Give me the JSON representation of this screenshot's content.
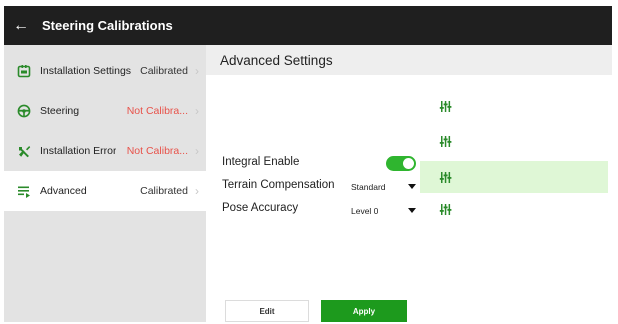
{
  "window": {
    "title": "Steering Calibrations",
    "back_glyph": "←"
  },
  "sidebar": {
    "items": [
      {
        "label": "Installation Settings",
        "status": "Calibrated",
        "status_kind": "ok",
        "icon": "installation-settings-icon",
        "active": false
      },
      {
        "label": "Steering",
        "status": "Not Calibra...",
        "status_kind": "bad",
        "icon": "steering-wheel-icon",
        "active": false
      },
      {
        "label": "Installation Error",
        "status": "Not Calibra...",
        "status_kind": "bad",
        "icon": "installation-error-icon",
        "active": false
      },
      {
        "label": "Advanced",
        "status": "Calibrated",
        "status_kind": "ok",
        "icon": "advanced-list-icon",
        "active": true
      }
    ],
    "chevron_glyph": "›"
  },
  "main": {
    "title": "Advanced Settings",
    "settings": {
      "integral_enable": {
        "label": "Integral Enable",
        "value": true
      },
      "terrain_compensation": {
        "label": "Terrain Compensation",
        "value": "Standard"
      },
      "pose_accuracy": {
        "label": "Pose Accuracy",
        "value": "Level 0"
      }
    },
    "tune_icon": "tune-sliders-icon",
    "buttons": {
      "edit": "Edit",
      "apply": "Apply"
    }
  },
  "colors": {
    "titlebar": "#1f1f1f",
    "accent_green": "#2fb52f",
    "apply_green": "#1d9a1d",
    "highlight_green": "#dff7d6",
    "status_error": "#e8524a"
  }
}
